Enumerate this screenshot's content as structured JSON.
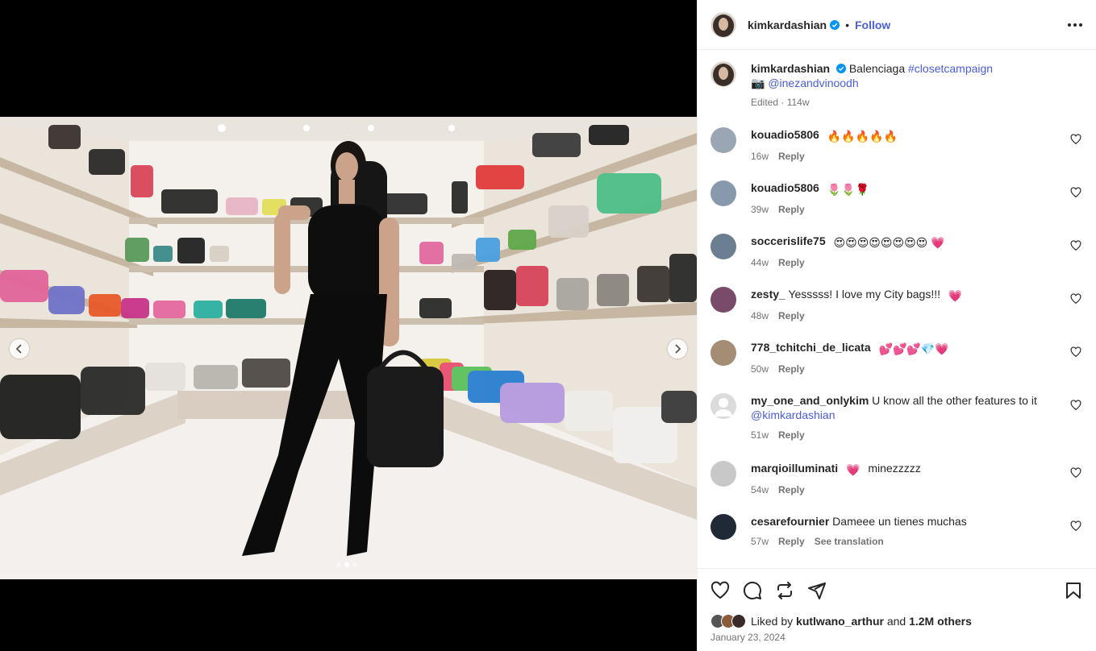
{
  "post": {
    "author": "kimkardashian",
    "follow_label": "Follow",
    "separator": "•",
    "more_icon": "more-options-icon",
    "caption": {
      "username": "kimkardashian",
      "text": "Balenciaga",
      "hashtag": "#closetcampaign",
      "camera_emoji": "📷",
      "mention": "@inezandvinoodh",
      "edited": "Edited · 114w"
    },
    "image_alt": "Woman in black strapless bodysuit holding a black handbag in a closet full of designer handbags",
    "carousel": {
      "slides": 3,
      "active": 2
    }
  },
  "comments": [
    {
      "username": "kouadio5806",
      "text": "",
      "emoji": "🔥🔥🔥🔥🔥",
      "time": "16w",
      "reply": "Reply",
      "avatar_color": "#9aa6b4"
    },
    {
      "username": "kouadio5806",
      "text": "",
      "emoji": "🌷🌷🌹",
      "time": "39w",
      "reply": "Reply",
      "avatar_color": "#8898ad"
    },
    {
      "username": "soccerislife75",
      "text": "",
      "emoji": "😍😍😍😍😍😍😍😍 💗",
      "time": "44w",
      "reply": "Reply",
      "avatar_color": "#6c7f92"
    },
    {
      "username": "zesty_",
      "text": "Yesssss! I love my City bags!!!",
      "emoji": "💗",
      "time": "48w",
      "reply": "Reply",
      "avatar_color": "#7a4a6a"
    },
    {
      "username": "778_tchitchi_de_licata",
      "text": "",
      "emoji": "💕💕💕💎💗",
      "time": "50w",
      "reply": "Reply",
      "avatar_color": "#a58c74"
    },
    {
      "username": "my_one_and_onlykim",
      "text": "U know all the other features to it",
      "mention": "@kimkardashian",
      "time": "51w",
      "reply": "Reply",
      "avatar_color": "#dbdbdb"
    },
    {
      "username": "marqioilluminati",
      "text": "minezzzzz",
      "emoji_before": "💗",
      "time": "54w",
      "reply": "Reply",
      "avatar_color": "#c8c8c8"
    },
    {
      "username": "cesarefournier",
      "text": "Dameee un tienes muchas",
      "time": "57w",
      "reply": "Reply",
      "translate": "See translation",
      "avatar_color": "#1f2a36"
    }
  ],
  "actions": {
    "like_icon": "heart-icon",
    "comment_icon": "comment-icon",
    "share_icon": "repost-icon",
    "send_icon": "send-icon",
    "save_icon": "bookmark-icon"
  },
  "likes": {
    "prefix": "Liked by",
    "user": "kutlwano_arthur",
    "and": "and",
    "others": "1.2M others"
  },
  "date": "January 23, 2024",
  "colors": {
    "link": "#4a5ddb",
    "verified": "#0095f6",
    "like_heart": "#ff3040"
  }
}
